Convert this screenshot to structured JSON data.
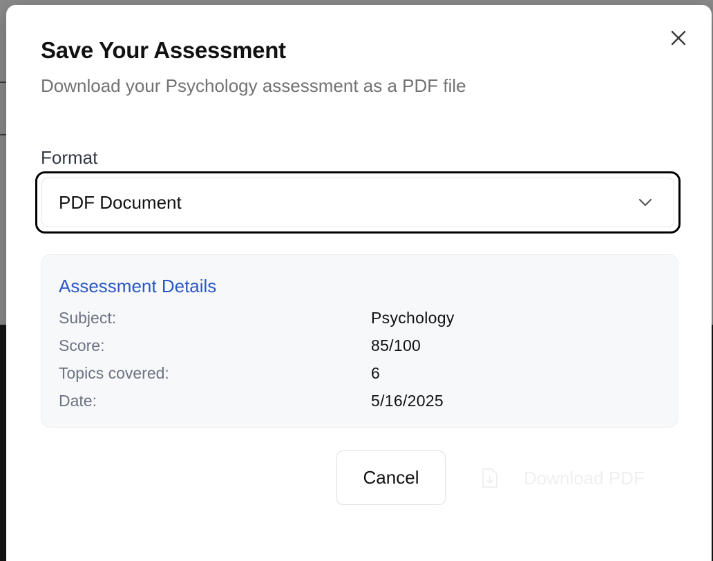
{
  "dialog": {
    "title": "Save Your Assessment",
    "subtitle": "Download your Psychology assessment as a PDF file",
    "close_icon": "close-icon"
  },
  "format": {
    "label": "Format",
    "selected": "PDF Document",
    "chevron_icon": "chevron-down-icon"
  },
  "details": {
    "title": "Assessment Details",
    "rows": [
      {
        "label": "Subject:",
        "value": "Psychology"
      },
      {
        "label": "Score:",
        "value": "85/100"
      },
      {
        "label": "Topics covered:",
        "value": "6"
      },
      {
        "label": "Date:",
        "value": "5/16/2025"
      }
    ]
  },
  "actions": {
    "cancel_label": "Cancel",
    "download_label": "Download PDF",
    "download_icon": "file-download-icon"
  },
  "colors": {
    "accent": "#2b58c8",
    "focus_ring": "#000000",
    "panel_bg": "#f7f8fa"
  }
}
